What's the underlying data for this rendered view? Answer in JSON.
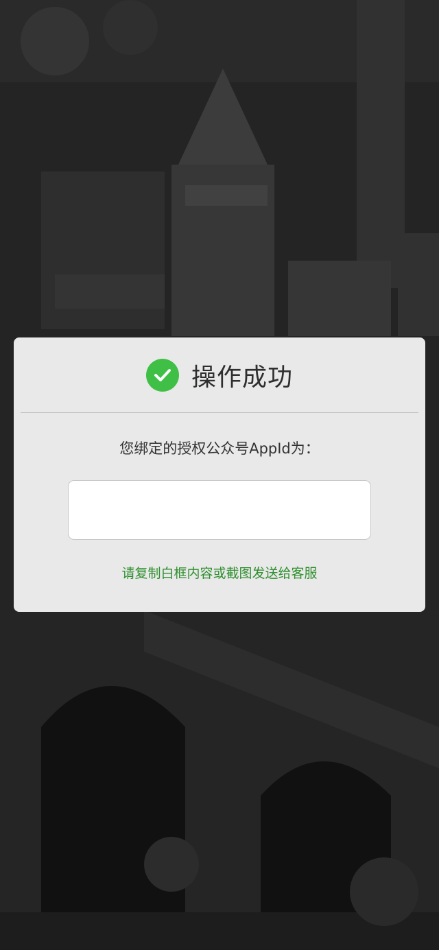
{
  "dialog": {
    "title": "操作成功",
    "status_icon": "check-circle-icon",
    "label": "您绑定的授权公众号AppId为：",
    "appid_value": "",
    "hint": "请复制白框内容或截图发送给客服"
  },
  "colors": {
    "success_green": "#3fbf46",
    "hint_green": "#2f8f2f",
    "dialog_bg": "#e9e9e9"
  }
}
